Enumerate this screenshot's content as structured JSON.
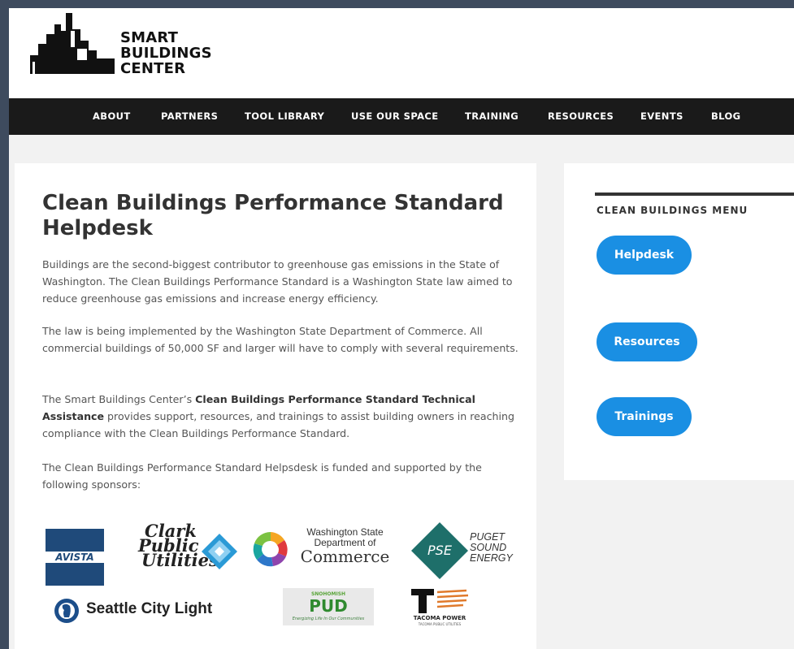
{
  "logo": {
    "line1": "SMART",
    "line2": "BUILDINGS",
    "line3": "CENTER"
  },
  "nav": {
    "items": [
      "ABOUT",
      "PARTNERS",
      "TOOL LIBRARY",
      "USE OUR SPACE",
      "TRAINING",
      "RESOURCES",
      "EVENTS",
      "BLOG"
    ]
  },
  "main": {
    "title": "Clean Buildings Performance Standard Helpdesk",
    "p1": "Buildings are the second-biggest contributor to greenhouse gas emissions in the State of Washington. The Clean Buildings Performance Standard is a Washington State law aimed to reduce greenhouse gas emissions and increase energy efficiency.",
    "p2": "The law is being implemented by the Washington State Department of Commerce. All commercial buildings of 50,000 SF and larger will have to comply with several requirements.",
    "p3_pre": "The Smart Buildings Center’s ",
    "p3_bold": "Clean Buildings Performance Standard Technical Assistance",
    "p3_post": " provides support, resources, and trainings to assist building owners in reaching compliance with the Clean Buildings Performance Standard.",
    "p4": "The Clean Buildings Performance Standard Helpsdesk is funded and supported by the following sponsors:"
  },
  "sponsors": {
    "avista": "AVISTA",
    "clark": [
      "Clark",
      "Public",
      "Utilities"
    ],
    "commerce": [
      "Washington State",
      "Department of",
      "Commerce"
    ],
    "pse_badge": "PSE",
    "pse": [
      "PUGET",
      "SOUND",
      "ENERGY"
    ],
    "scl": "Seattle City Light",
    "pud_top": "SNOHOMISH",
    "pud": "PUD",
    "pud_tag": "Energizing Life In Our Communities",
    "tacoma": "TACOMA POWER",
    "tacoma_sub": "TACOMA PUBLIC UTILITIES"
  },
  "sidebar": {
    "title": "CLEAN BUILDINGS MENU",
    "buttons": [
      "Helpdesk",
      "Resources",
      "Trainings"
    ]
  },
  "colors": {
    "nav_bg": "#1a1a1a",
    "accent": "#1a8fe3",
    "frame": "#3e4b5e"
  }
}
